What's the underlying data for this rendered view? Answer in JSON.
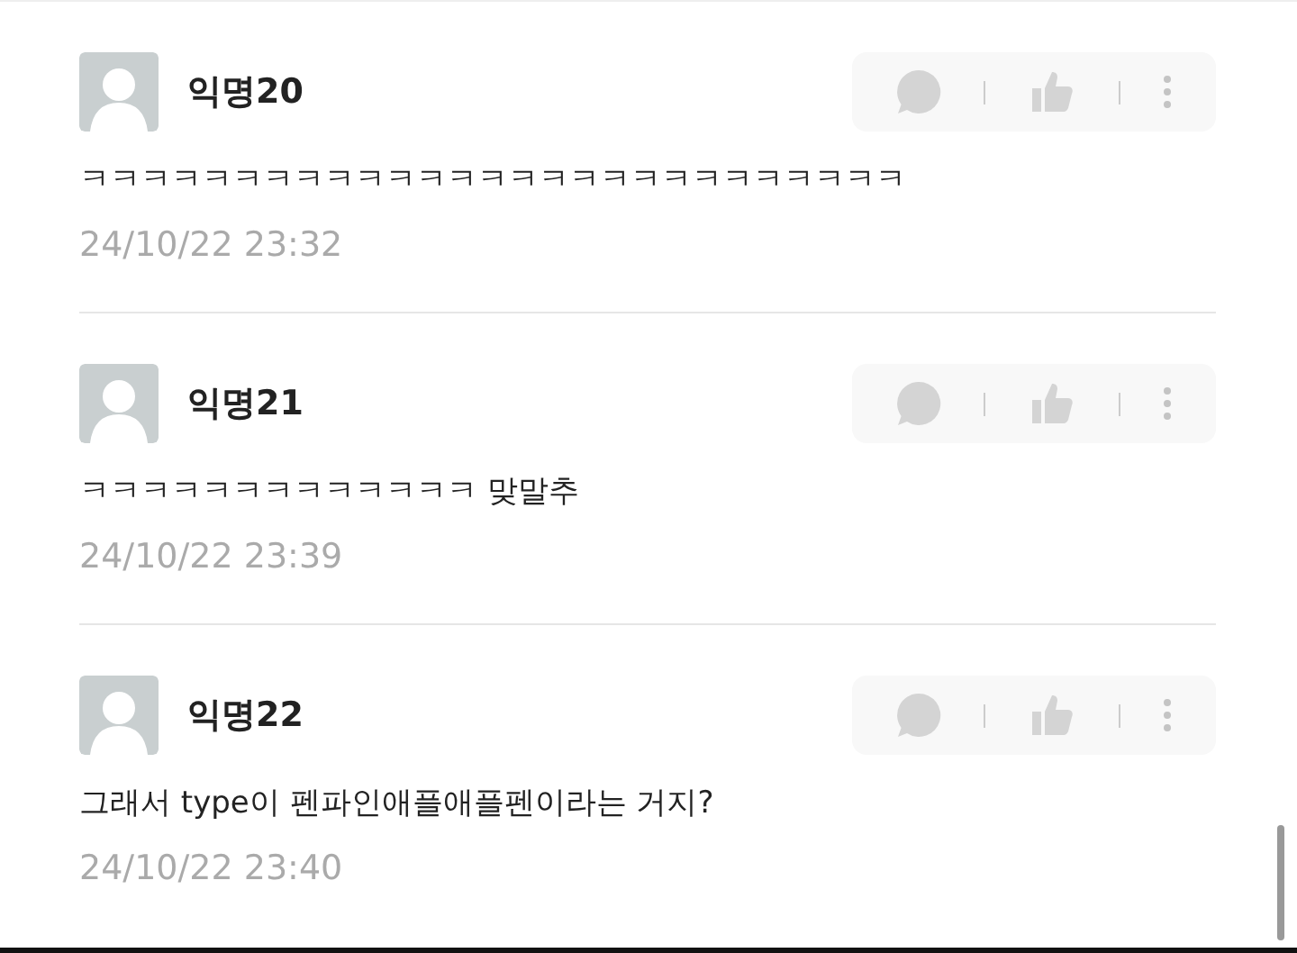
{
  "comments": [
    {
      "author": "익명20",
      "body": "ㅋㅋㅋㅋㅋㅋㅋㅋㅋㅋㅋㅋㅋㅋㅋㅋㅋㅋㅋㅋㅋㅋㅋㅋㅋㅋㅋ",
      "time": "24/10/22 23:32"
    },
    {
      "author": "익명21",
      "body": "ㅋㅋㅋㅋㅋㅋㅋㅋㅋㅋㅋㅋㅋ 맞말추",
      "time": "24/10/22 23:39"
    },
    {
      "author": "익명22",
      "body": "그래서 type이 펜파인애플애플펜이라는 거지?",
      "time": "24/10/22 23:40"
    }
  ]
}
